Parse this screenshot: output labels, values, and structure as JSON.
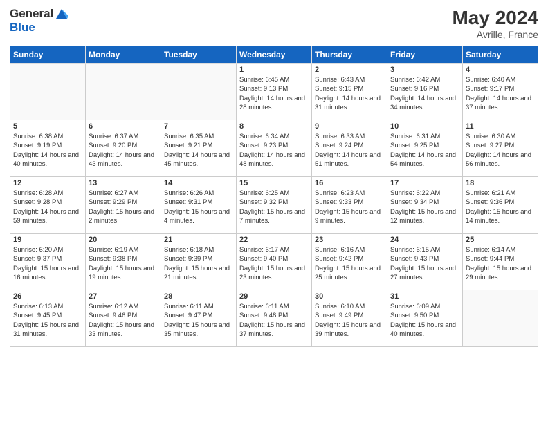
{
  "header": {
    "logo_general": "General",
    "logo_blue": "Blue",
    "month": "May 2024",
    "location": "Avrille, France"
  },
  "weekdays": [
    "Sunday",
    "Monday",
    "Tuesday",
    "Wednesday",
    "Thursday",
    "Friday",
    "Saturday"
  ],
  "weeks": [
    [
      {
        "day": "",
        "empty": true
      },
      {
        "day": "",
        "empty": true
      },
      {
        "day": "",
        "empty": true
      },
      {
        "day": "1",
        "sunrise": "6:45 AM",
        "sunset": "9:13 PM",
        "daylight": "14 hours and 28 minutes."
      },
      {
        "day": "2",
        "sunrise": "6:43 AM",
        "sunset": "9:15 PM",
        "daylight": "14 hours and 31 minutes."
      },
      {
        "day": "3",
        "sunrise": "6:42 AM",
        "sunset": "9:16 PM",
        "daylight": "14 hours and 34 minutes."
      },
      {
        "day": "4",
        "sunrise": "6:40 AM",
        "sunset": "9:17 PM",
        "daylight": "14 hours and 37 minutes."
      }
    ],
    [
      {
        "day": "5",
        "sunrise": "6:38 AM",
        "sunset": "9:19 PM",
        "daylight": "14 hours and 40 minutes."
      },
      {
        "day": "6",
        "sunrise": "6:37 AM",
        "sunset": "9:20 PM",
        "daylight": "14 hours and 43 minutes."
      },
      {
        "day": "7",
        "sunrise": "6:35 AM",
        "sunset": "9:21 PM",
        "daylight": "14 hours and 45 minutes."
      },
      {
        "day": "8",
        "sunrise": "6:34 AM",
        "sunset": "9:23 PM",
        "daylight": "14 hours and 48 minutes."
      },
      {
        "day": "9",
        "sunrise": "6:33 AM",
        "sunset": "9:24 PM",
        "daylight": "14 hours and 51 minutes."
      },
      {
        "day": "10",
        "sunrise": "6:31 AM",
        "sunset": "9:25 PM",
        "daylight": "14 hours and 54 minutes."
      },
      {
        "day": "11",
        "sunrise": "6:30 AM",
        "sunset": "9:27 PM",
        "daylight": "14 hours and 56 minutes."
      }
    ],
    [
      {
        "day": "12",
        "sunrise": "6:28 AM",
        "sunset": "9:28 PM",
        "daylight": "14 hours and 59 minutes."
      },
      {
        "day": "13",
        "sunrise": "6:27 AM",
        "sunset": "9:29 PM",
        "daylight": "15 hours and 2 minutes."
      },
      {
        "day": "14",
        "sunrise": "6:26 AM",
        "sunset": "9:31 PM",
        "daylight": "15 hours and 4 minutes."
      },
      {
        "day": "15",
        "sunrise": "6:25 AM",
        "sunset": "9:32 PM",
        "daylight": "15 hours and 7 minutes."
      },
      {
        "day": "16",
        "sunrise": "6:23 AM",
        "sunset": "9:33 PM",
        "daylight": "15 hours and 9 minutes."
      },
      {
        "day": "17",
        "sunrise": "6:22 AM",
        "sunset": "9:34 PM",
        "daylight": "15 hours and 12 minutes."
      },
      {
        "day": "18",
        "sunrise": "6:21 AM",
        "sunset": "9:36 PM",
        "daylight": "15 hours and 14 minutes."
      }
    ],
    [
      {
        "day": "19",
        "sunrise": "6:20 AM",
        "sunset": "9:37 PM",
        "daylight": "15 hours and 16 minutes."
      },
      {
        "day": "20",
        "sunrise": "6:19 AM",
        "sunset": "9:38 PM",
        "daylight": "15 hours and 19 minutes."
      },
      {
        "day": "21",
        "sunrise": "6:18 AM",
        "sunset": "9:39 PM",
        "daylight": "15 hours and 21 minutes."
      },
      {
        "day": "22",
        "sunrise": "6:17 AM",
        "sunset": "9:40 PM",
        "daylight": "15 hours and 23 minutes."
      },
      {
        "day": "23",
        "sunrise": "6:16 AM",
        "sunset": "9:42 PM",
        "daylight": "15 hours and 25 minutes."
      },
      {
        "day": "24",
        "sunrise": "6:15 AM",
        "sunset": "9:43 PM",
        "daylight": "15 hours and 27 minutes."
      },
      {
        "day": "25",
        "sunrise": "6:14 AM",
        "sunset": "9:44 PM",
        "daylight": "15 hours and 29 minutes."
      }
    ],
    [
      {
        "day": "26",
        "sunrise": "6:13 AM",
        "sunset": "9:45 PM",
        "daylight": "15 hours and 31 minutes."
      },
      {
        "day": "27",
        "sunrise": "6:12 AM",
        "sunset": "9:46 PM",
        "daylight": "15 hours and 33 minutes."
      },
      {
        "day": "28",
        "sunrise": "6:11 AM",
        "sunset": "9:47 PM",
        "daylight": "15 hours and 35 minutes."
      },
      {
        "day": "29",
        "sunrise": "6:11 AM",
        "sunset": "9:48 PM",
        "daylight": "15 hours and 37 minutes."
      },
      {
        "day": "30",
        "sunrise": "6:10 AM",
        "sunset": "9:49 PM",
        "daylight": "15 hours and 39 minutes."
      },
      {
        "day": "31",
        "sunrise": "6:09 AM",
        "sunset": "9:50 PM",
        "daylight": "15 hours and 40 minutes."
      },
      {
        "day": "",
        "empty": true
      }
    ]
  ]
}
